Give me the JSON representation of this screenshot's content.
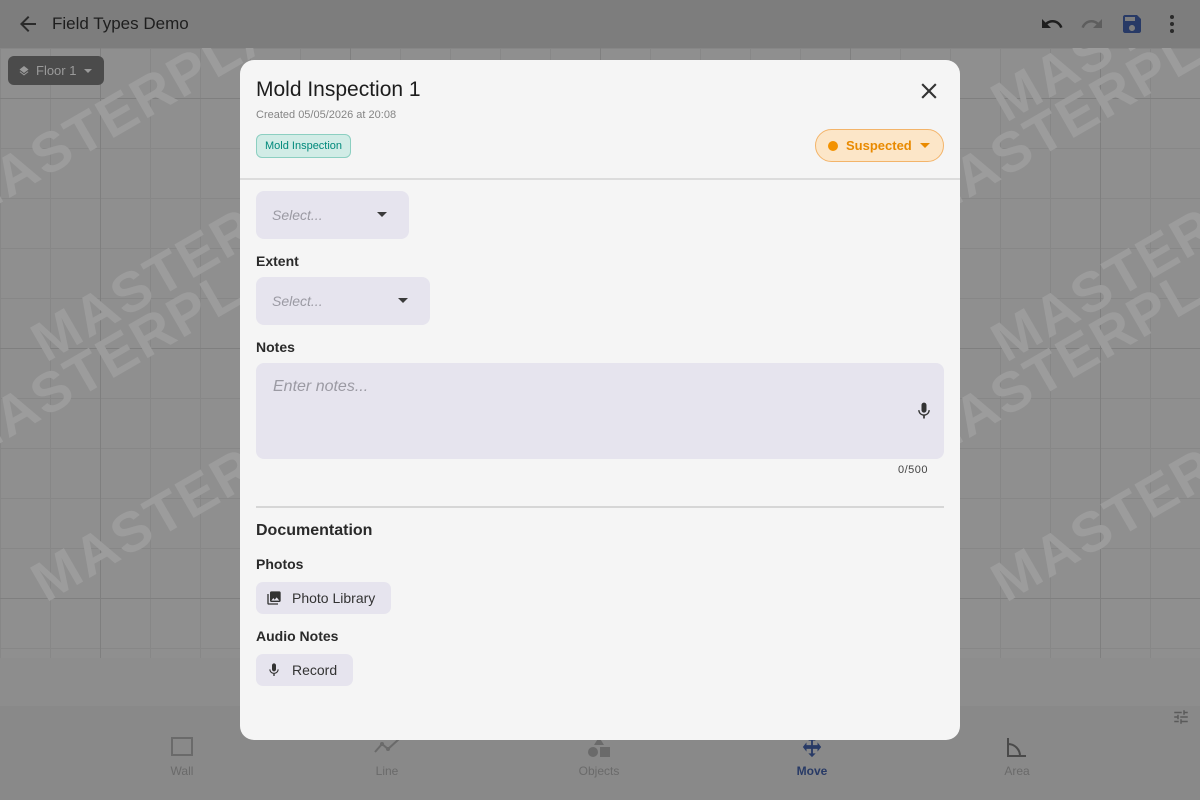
{
  "app": {
    "title": "Field Types Demo",
    "floor": "Floor 1",
    "watermark": "MASTERPLAN"
  },
  "bottom_nav": [
    {
      "label": "Wall",
      "icon": "wall-icon"
    },
    {
      "label": "Line",
      "icon": "line-icon"
    },
    {
      "label": "Objects",
      "icon": "objects-icon"
    },
    {
      "label": "Move",
      "icon": "move-icon",
      "active": true
    },
    {
      "label": "Area",
      "icon": "area-icon"
    }
  ],
  "modal": {
    "title": "Mold Inspection 1",
    "created": "Created 05/05/2026 at 20:08",
    "type_chip": "Mold Inspection",
    "status": {
      "label": "Suspected",
      "color": "#f39200"
    },
    "first_select": {
      "placeholder": "Select..."
    },
    "extent": {
      "label": "Extent",
      "placeholder": "Select..."
    },
    "notes": {
      "label": "Notes",
      "placeholder": "Enter notes...",
      "counter": "0/500"
    },
    "documentation": {
      "title": "Documentation",
      "photos_label": "Photos",
      "photos_button": "Photo Library",
      "audio_label": "Audio Notes",
      "audio_button": "Record"
    }
  },
  "colors": {
    "accent_teal": "#00897b",
    "status_orange": "#e98a00",
    "nav_active": "#283a66"
  }
}
